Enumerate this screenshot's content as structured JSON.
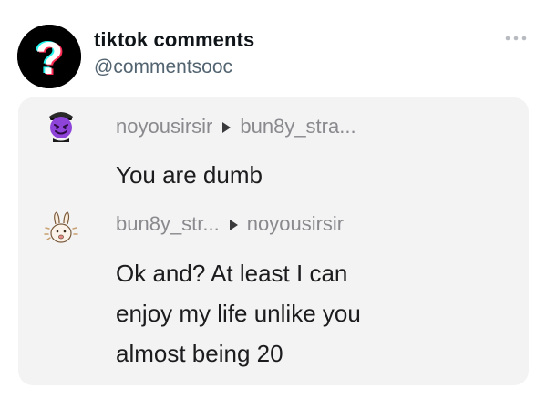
{
  "header": {
    "account_name": "tiktok comments",
    "account_handle": "@commentsooc",
    "more_icon": "more-horizontal-icon",
    "avatar_icon": "question-mark-logo"
  },
  "colors": {
    "card_background": "#f3f3f4",
    "username_gray": "#8a8a8e",
    "text_dark": "#1c1c1e",
    "handle_gray": "#536471",
    "logo_cyan": "#25f4ee",
    "logo_red": "#fe2c55"
  },
  "comments": [
    {
      "avatar_icon": "purple-devil-emoji",
      "author": "noyousirsir",
      "reply_to": "bun8y_stra...",
      "text_lines": [
        "You are dumb"
      ]
    },
    {
      "avatar_icon": "rabbit-sketch-avatar",
      "author": "bun8y_str...",
      "reply_to": "noyousirsir",
      "text_lines": [
        "Ok and? At least I can",
        "enjoy my life unlike you",
        "almost being 20"
      ]
    }
  ]
}
